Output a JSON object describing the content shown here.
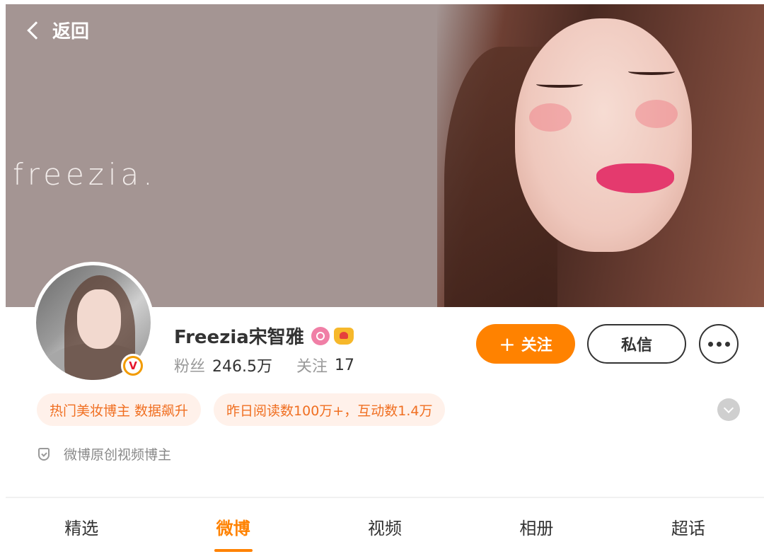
{
  "header": {
    "back_label": "返回"
  },
  "cover": {
    "watermark_text": "freezia."
  },
  "profile": {
    "name": "Freezia宋智雅",
    "fans_label": "粉丝",
    "fans_value": "246.5万",
    "following_label": "关注",
    "following_value": "17",
    "verified_badge": "V"
  },
  "actions": {
    "follow_plus": "+",
    "follow_label": "关注",
    "message_label": "私信"
  },
  "tags": [
    "热门美妆博主 数据飙升",
    "昨日阅读数100万+，互动数1.4万"
  ],
  "verification_text": "微博原创视频博主",
  "tabs": [
    {
      "label": "精选"
    },
    {
      "label": "微博"
    },
    {
      "label": "视频"
    },
    {
      "label": "相册"
    },
    {
      "label": "超话"
    }
  ],
  "active_tab": "微博",
  "colors": {
    "accent": "#ff8200",
    "tag_text": "#f06f21",
    "tag_bg": "#fff1ea"
  },
  "icons": [
    "back-chevron-icon",
    "vip-pink-icon",
    "gold-crown-icon",
    "verified-v-icon",
    "more-dots-icon",
    "expand-chevron-icon",
    "shield-icon"
  ]
}
